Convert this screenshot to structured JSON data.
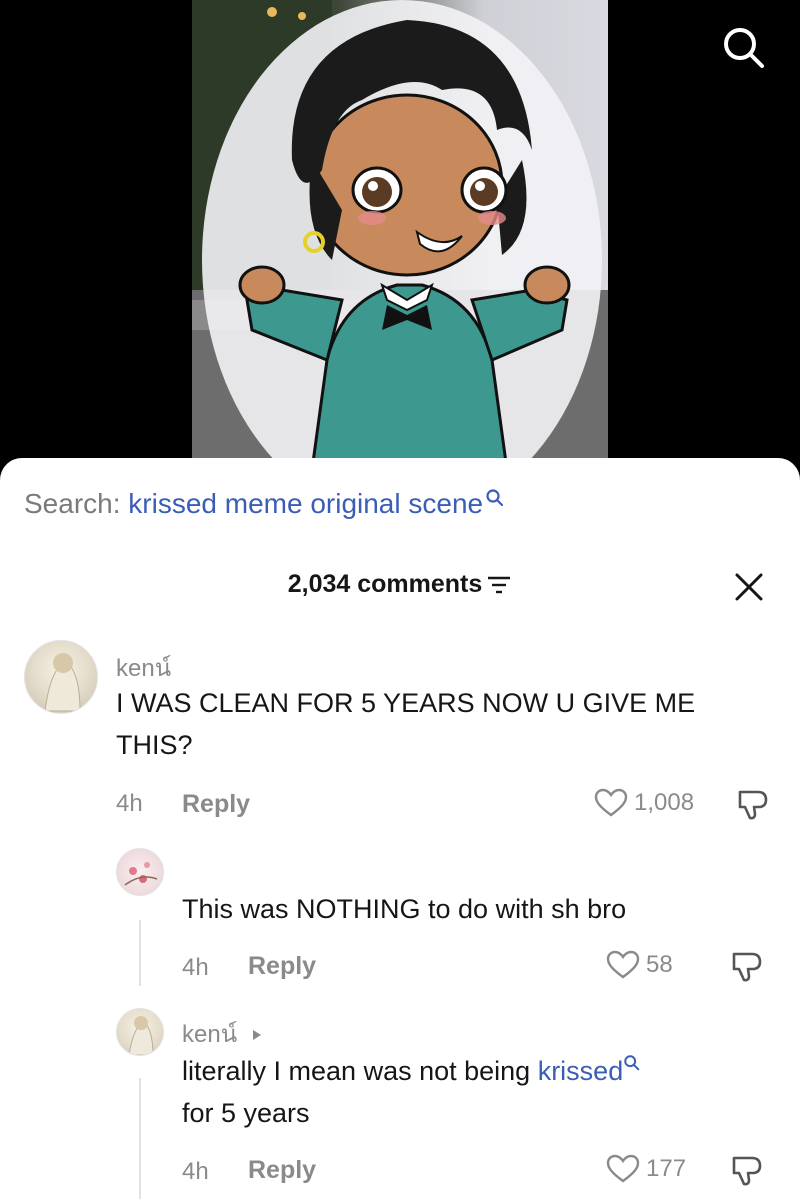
{
  "search_bar": {
    "prefix": "Search:",
    "term": "krissed meme original scene"
  },
  "comments_header": {
    "count_label": "2,034 comments"
  },
  "comments": [
    {
      "username": "kenน์",
      "text": "I WAS CLEAN FOR 5 YEARS NOW U GIVE ME THIS?",
      "time": "4h",
      "reply_label": "Reply",
      "likes": "1,008"
    }
  ],
  "replies": [
    {
      "username": "",
      "text": "This was NOTHING to do with sh bro",
      "time": "4h",
      "reply_label": "Reply",
      "likes": "58"
    },
    {
      "username": "kenน์",
      "text_before": "literally I mean was not being ",
      "text_keyword": "krissed",
      "text_after": "for 5 years",
      "time": "4h",
      "reply_label": "Reply",
      "likes": "177"
    }
  ],
  "icons": {
    "top_search": "search-icon",
    "sort": "sort-icon",
    "close": "close-icon",
    "like": "heart-icon",
    "dislike": "dislike-icon",
    "reply_arrow": "play-triangle-icon"
  },
  "colors": {
    "link_blue": "#3b5db8",
    "muted_gray": "#8a8a8a",
    "text": "#161616"
  }
}
